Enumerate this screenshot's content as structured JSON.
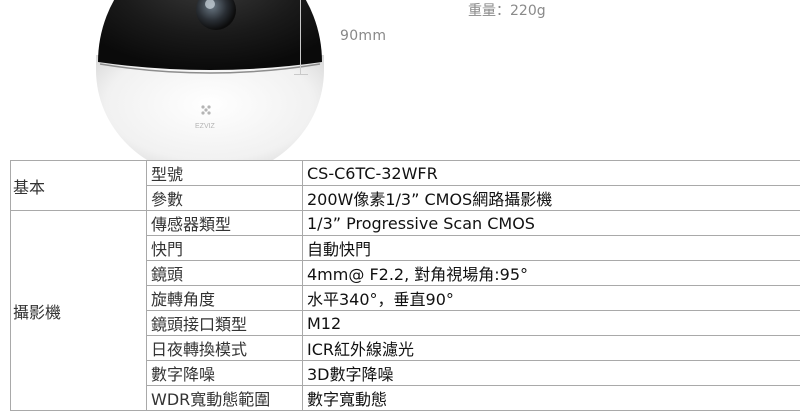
{
  "header": {
    "weight_label": "重量：220g",
    "dimension_label": "90mm",
    "logo_text": "EZVIZ"
  },
  "spec_table": {
    "groups": [
      {
        "category": "基本",
        "rows": [
          {
            "label": "型號",
            "value": "CS-C6TC-32WFR"
          },
          {
            "label": "參數",
            "value": "200W像素1/3”  CMOS網路攝影機"
          }
        ]
      },
      {
        "category": "攝影機",
        "rows": [
          {
            "label": "傳感器類型",
            "value": "1/3”  Progressive Scan CMOS"
          },
          {
            "label": "快門",
            "value": "自動快門"
          },
          {
            "label": "鏡頭",
            "value": "4mm@ F2.2, 對角視場角:95°"
          },
          {
            "label": "旋轉角度",
            "value": "水平340°，垂直90°"
          },
          {
            "label": "鏡頭接口類型",
            "value": "M12"
          },
          {
            "label": "日夜轉換模式",
            "value": "ICR紅外線濾光"
          },
          {
            "label": "數字降噪",
            "value": "3D數字降噪"
          },
          {
            "label": "WDR寬動態範圍",
            "value": "數字寬動態"
          }
        ]
      }
    ]
  },
  "colors": {
    "border": "#a9a9a9",
    "text": "#333333",
    "camera_dark": "#1c1c1c",
    "camera_white": "#f4f4f4"
  }
}
